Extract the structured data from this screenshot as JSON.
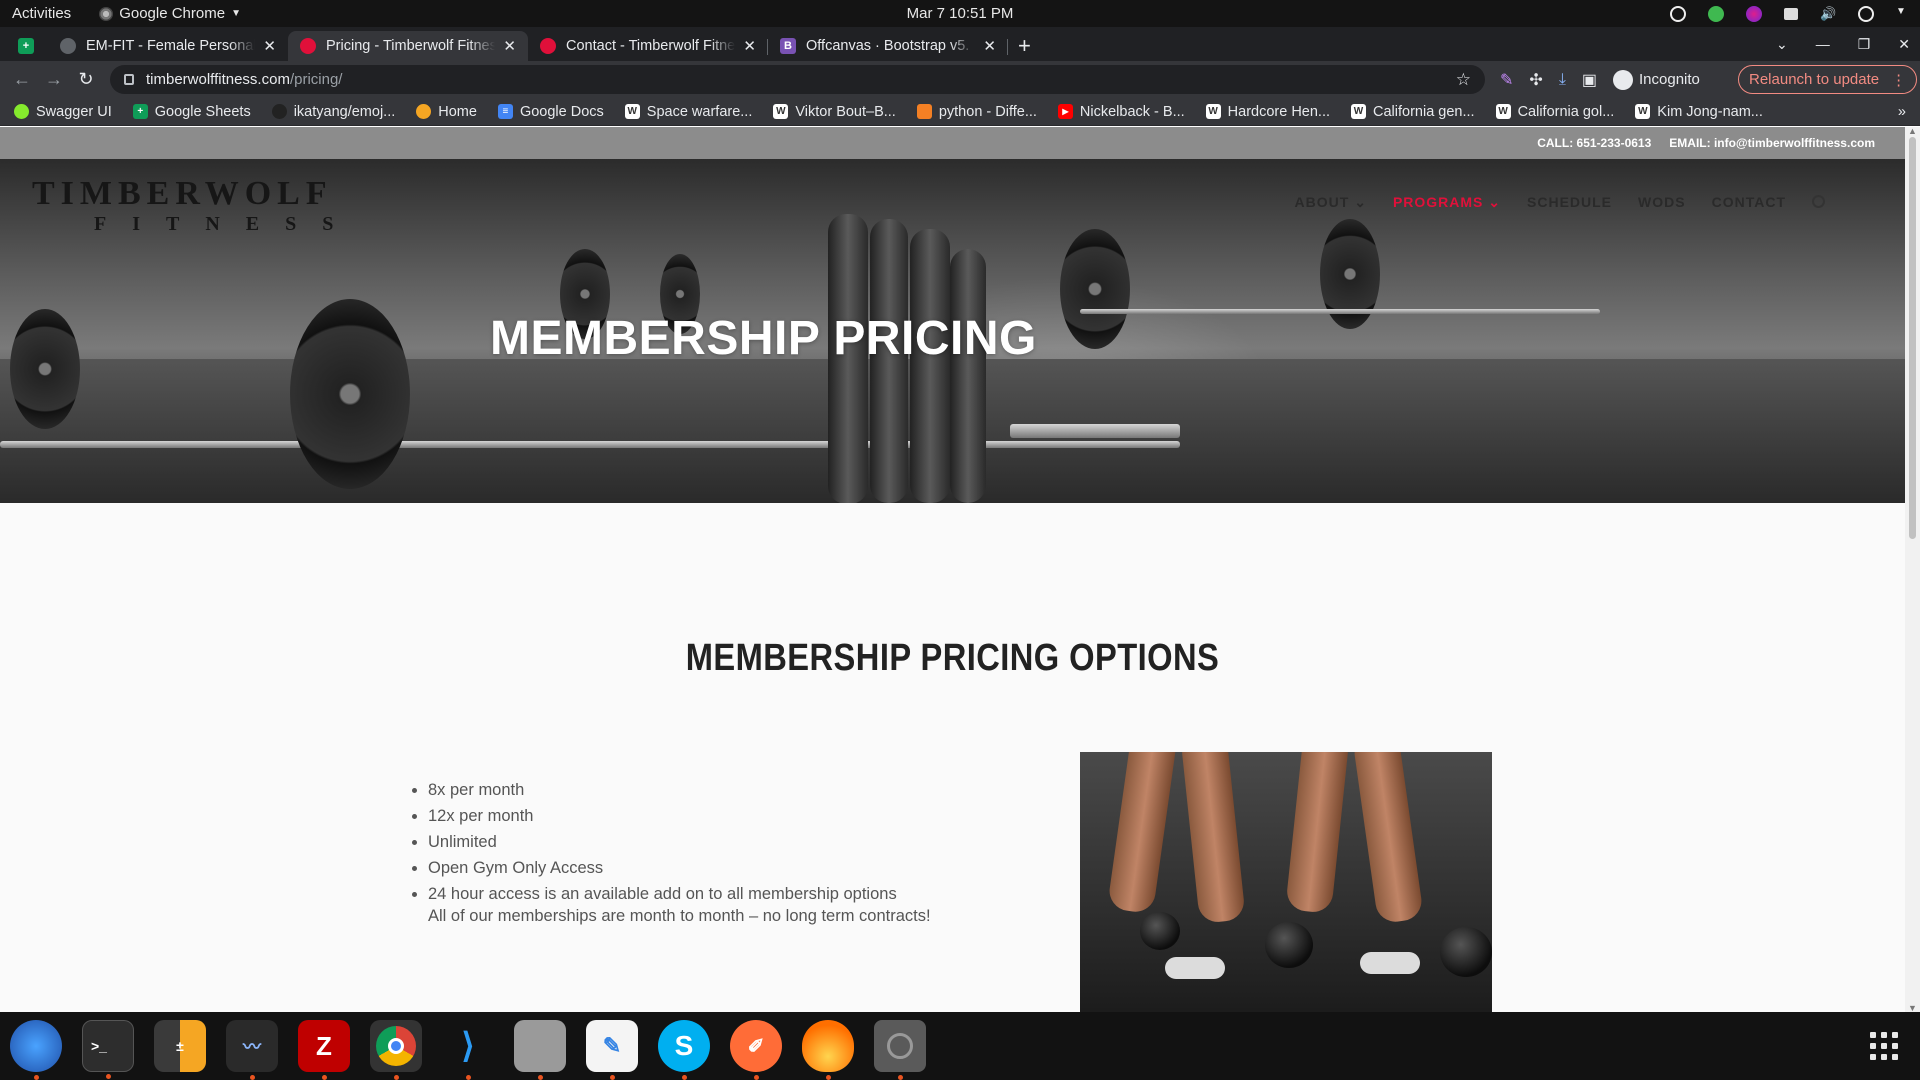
{
  "system": {
    "activities": "Activities",
    "app_name": "Google Chrome",
    "clock": "Mar 7  10:51 PM"
  },
  "tabs": [
    {
      "title": "EM-FIT - Female Personal",
      "favicon_color": "#5f6368",
      "active": false
    },
    {
      "title": "Pricing - Timberwolf Fitness",
      "favicon_color": "#e0103a",
      "active": true
    },
    {
      "title": "Contact - Timberwolf Fitness",
      "favicon_color": "#e0103a",
      "active": false
    },
    {
      "title": "Offcanvas · Bootstrap v5.",
      "favicon_color": "#7952b3",
      "favicon_letter": "B",
      "active": false
    }
  ],
  "toolbar": {
    "url_host": "timberwolffitness.com",
    "url_path": "/pricing/",
    "incognito_label": "Incognito",
    "relaunch_label": "Relaunch to update"
  },
  "bookmarks": [
    {
      "label": "Swagger UI",
      "color": "#85ea2d"
    },
    {
      "label": "Google Sheets",
      "color": "#0f9d58"
    },
    {
      "label": "ikatyang/emoj...",
      "color": "#333333"
    },
    {
      "label": "Home",
      "color": "#f5a623"
    },
    {
      "label": "Google Docs",
      "color": "#4285f4"
    },
    {
      "label": "Space warfare...",
      "color": "#ffffff"
    },
    {
      "label": "Viktor Bout–B...",
      "color": "#ffffff"
    },
    {
      "label": "python - Diffe...",
      "color": "#f48024"
    },
    {
      "label": "Nickelback - B...",
      "color": "#ff0000"
    },
    {
      "label": "Hardcore Hen...",
      "color": "#ffffff"
    },
    {
      "label": "California gen...",
      "color": "#ffffff"
    },
    {
      "label": "California gol...",
      "color": "#ffffff"
    },
    {
      "label": "Kim Jong-nam...",
      "color": "#ffffff"
    }
  ],
  "site": {
    "call": "CALL: 651-233-0613",
    "email": "EMAIL: info@timberwolffitness.com",
    "logo_line1": "TIMBERWOLF",
    "logo_line2": "FITNESS",
    "menu": [
      {
        "label": "ABOUT",
        "dropdown": true,
        "active": false
      },
      {
        "label": "PROGRAMS",
        "dropdown": true,
        "active": true
      },
      {
        "label": "SCHEDULE",
        "dropdown": false,
        "active": false
      },
      {
        "label": "WODS",
        "dropdown": false,
        "active": false
      },
      {
        "label": "CONTACT",
        "dropdown": false,
        "active": false
      }
    ],
    "hero_title": "MEMBERSHIP PRICING",
    "section_title": "MEMBERSHIP PRICING OPTIONS",
    "pricing_items": [
      "8x per month",
      "12x per month",
      "Unlimited",
      "Open Gym Only Access",
      "24 hour access is an available add on to all membership options"
    ],
    "note": "All of our memberships are month to month – no long term contracts!",
    "accent_color": "#e0103a"
  },
  "dock": [
    {
      "name": "thunderbird-icon",
      "color": "#1f6fd6"
    },
    {
      "name": "terminal-icon",
      "color": "#2d2d2d"
    },
    {
      "name": "calculator-icon",
      "color": "#f5a623"
    },
    {
      "name": "system-monitor-icon",
      "color": "#2a2a2a"
    },
    {
      "name": "filezilla-icon",
      "color": "#bf0000"
    },
    {
      "name": "chrome-icon",
      "color": "#4285f4"
    },
    {
      "name": "vscode-icon",
      "color": "#1e88e5"
    },
    {
      "name": "files-icon",
      "color": "#8a8a8a"
    },
    {
      "name": "text-editor-icon",
      "color": "#3584e4"
    },
    {
      "name": "skype-icon",
      "color": "#00aff0"
    },
    {
      "name": "postman-icon",
      "color": "#ff6c37"
    },
    {
      "name": "blender-flame-icon",
      "color": "#ff9800"
    },
    {
      "name": "disk-icon",
      "color": "#666666"
    }
  ]
}
